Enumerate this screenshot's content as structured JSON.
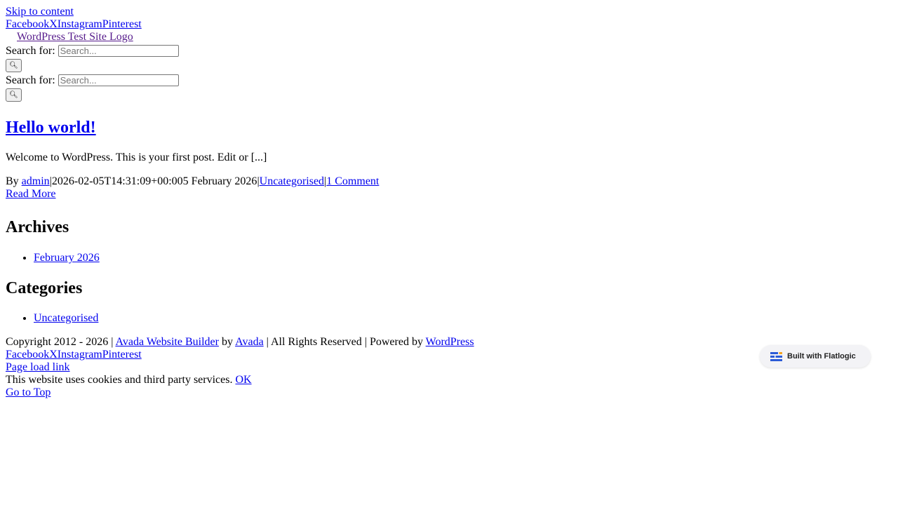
{
  "skip_link": "Skip to content",
  "social_header": [
    "Facebook",
    "X",
    "Instagram",
    "Pinterest"
  ],
  "logo_alt": "WordPress Test Site Logo",
  "search": {
    "label": "Search for:",
    "placeholder": "Search...",
    "button_icon": "search-icon",
    "button_glyph": "🔍"
  },
  "post": {
    "title": "Hello world!",
    "excerpt": "Welcome to WordPress. This is your first post. Edit or [...]",
    "by": "By ",
    "author": "admin",
    "sep": "|",
    "datetime_raw": "2026-02-05T14:31:09+00:00",
    "date": "5 February 2026",
    "category": "Uncategorised",
    "comments": "1 Comment",
    "read_more": "Read More"
  },
  "archives": {
    "heading": "Archives",
    "items": [
      "February 2026"
    ]
  },
  "categories": {
    "heading": "Categories",
    "items": [
      "Uncategorised"
    ]
  },
  "footer": {
    "copyright": "Copyright 2012 - 2026 | ",
    "builder_link": "Avada Website Builder",
    "by": " by ",
    "avada_link": "Avada",
    "rights": " | All Rights Reserved | Powered by ",
    "wp_link": "WordPress",
    "social": [
      "Facebook",
      "X",
      "Instagram",
      "Pinterest"
    ],
    "page_load_link": "Page load link",
    "cookie_text": "This website uses cookies and third party services. ",
    "cookie_ok": "OK",
    "go_top": "Go to Top"
  },
  "badge": {
    "text": "Built with Flatlogic",
    "icon": "flatlogic-logo-icon",
    "colors": {
      "bars": "#2b5bd7",
      "accent": "#f3a321"
    }
  }
}
